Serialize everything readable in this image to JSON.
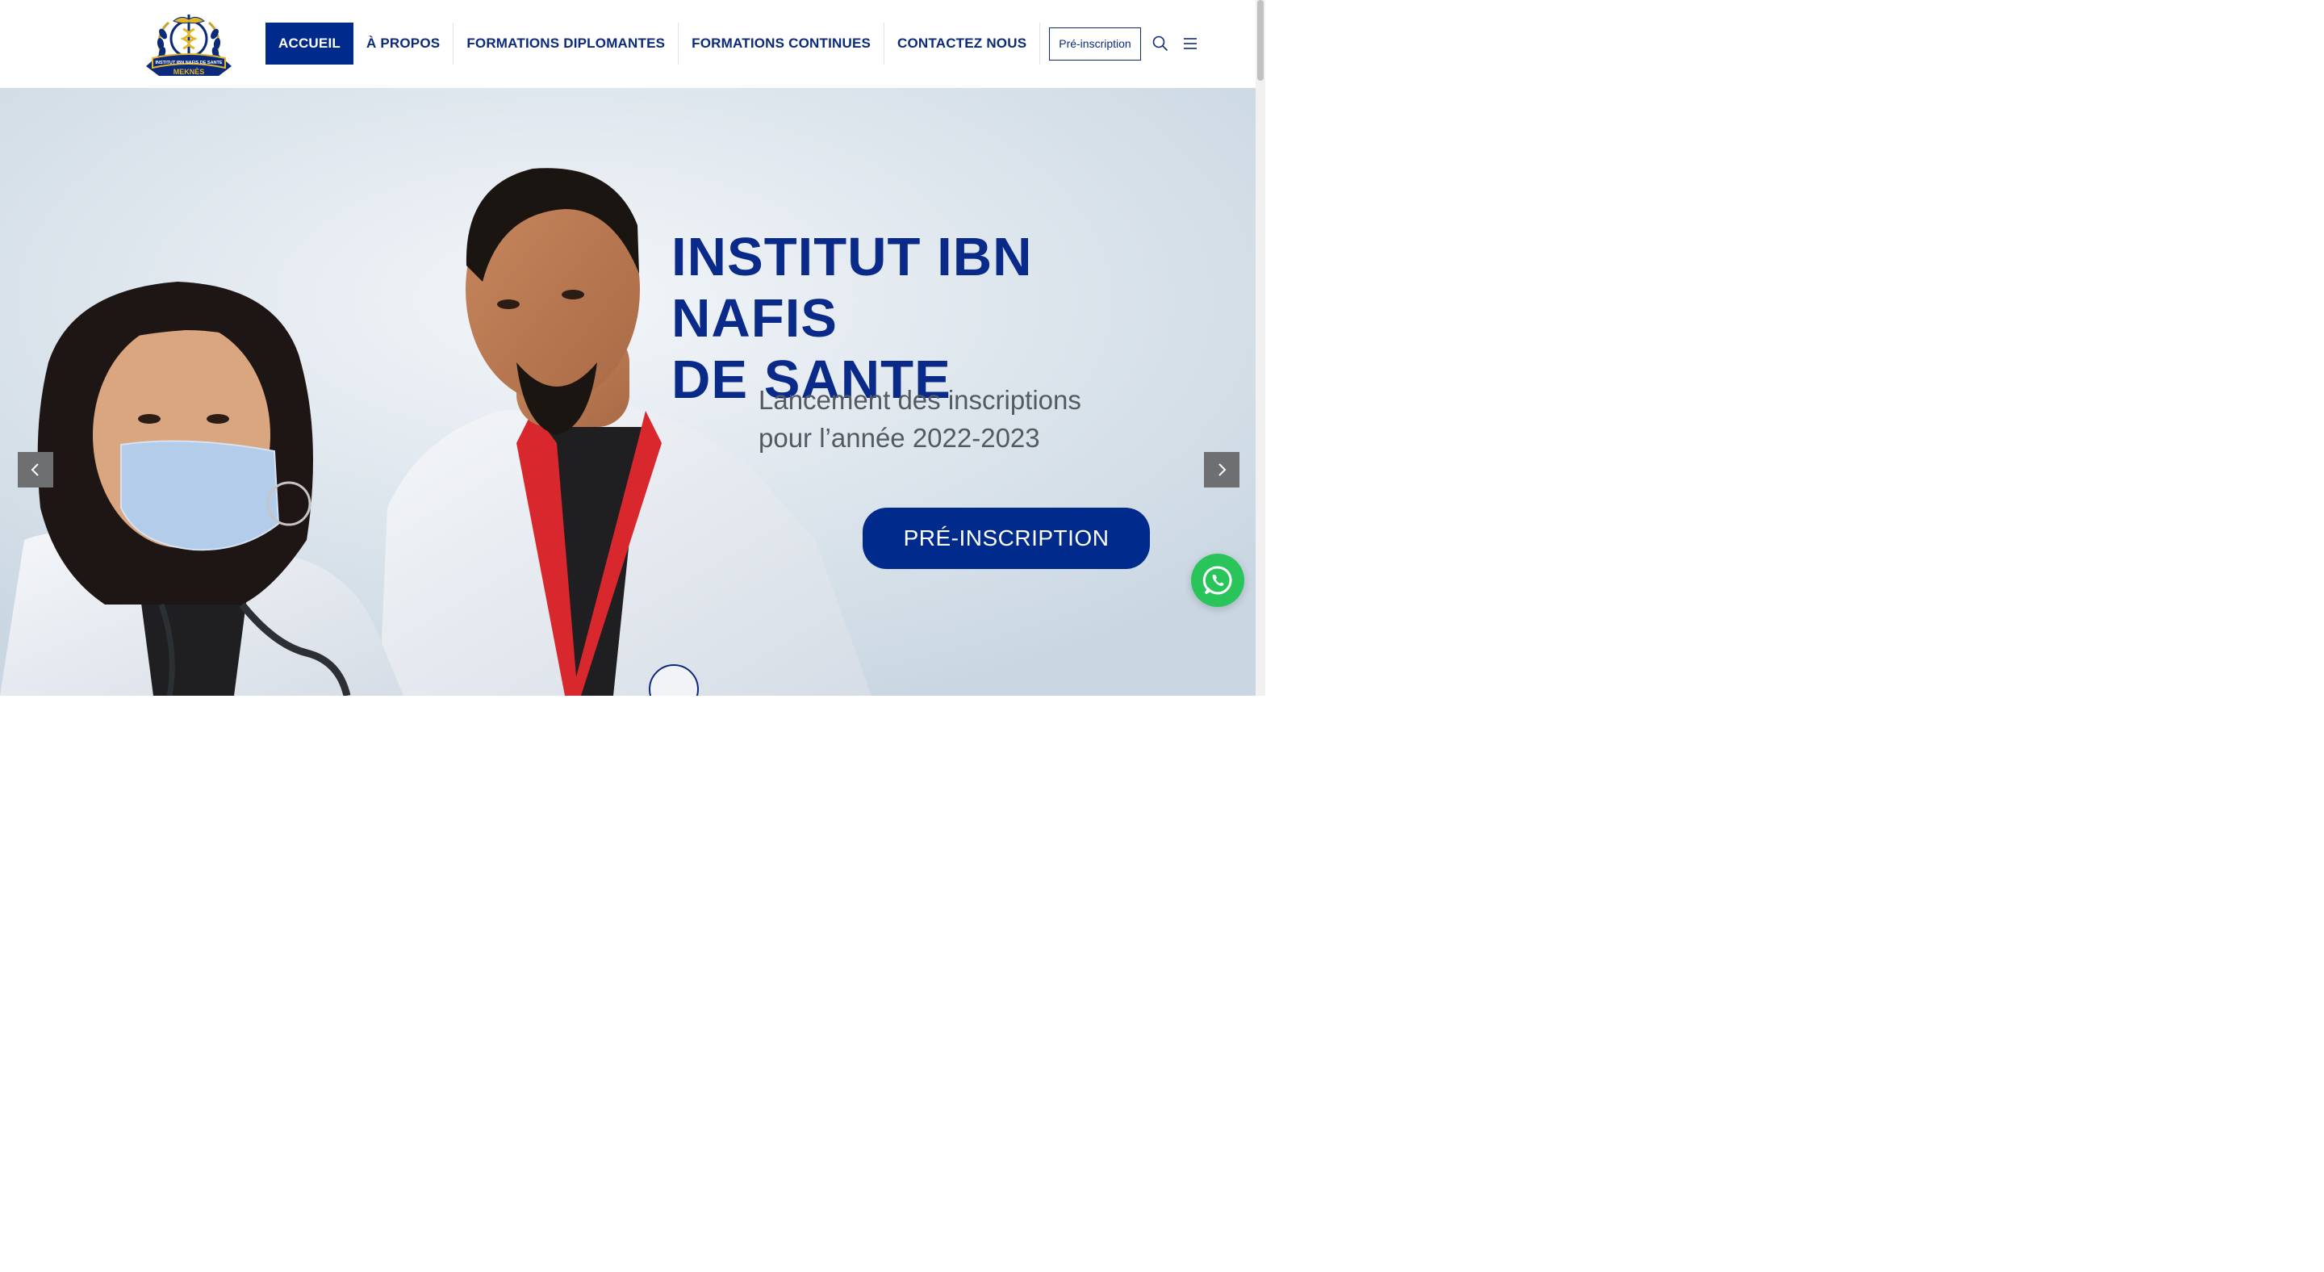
{
  "brand": {
    "logo_alt": "Institut Ibn Nafis de Santé Meknès logo",
    "logo_ribbon": "INSTITUT IBN NAFIS DE SANTE",
    "logo_city": "MEKNÈS"
  },
  "nav": {
    "items": [
      {
        "label": "ACCUEIL",
        "active": true
      },
      {
        "label": "À PROPOS",
        "active": false
      },
      {
        "label": "FORMATIONS DIPLOMANTES",
        "active": false
      },
      {
        "label": "FORMATIONS CONTINUES",
        "active": false
      },
      {
        "label": "CONTACTEZ NOUS",
        "active": false
      }
    ],
    "preinscription_label": "Pré-inscription",
    "search_icon": "search-icon",
    "menu_icon": "hamburger-menu-icon"
  },
  "hero": {
    "title_line1": "INSTITUT IBN NAFIS",
    "title_line2": "DE SANTE",
    "subtitle_line1": "Lancement des inscriptions",
    "subtitle_line2": "pour l’année 2022-2023",
    "cta_label": "PRÉ-INSCRIPTION",
    "prev_icon": "chevron-left-icon",
    "next_icon": "chevron-right-icon"
  },
  "floating": {
    "whatsapp_icon": "whatsapp-icon"
  },
  "colors": {
    "brand_blue": "#002a8c",
    "title_blue": "#0a2a8a",
    "whatsapp_green": "#29c55b",
    "arrow_grey": "#6e6f70"
  }
}
